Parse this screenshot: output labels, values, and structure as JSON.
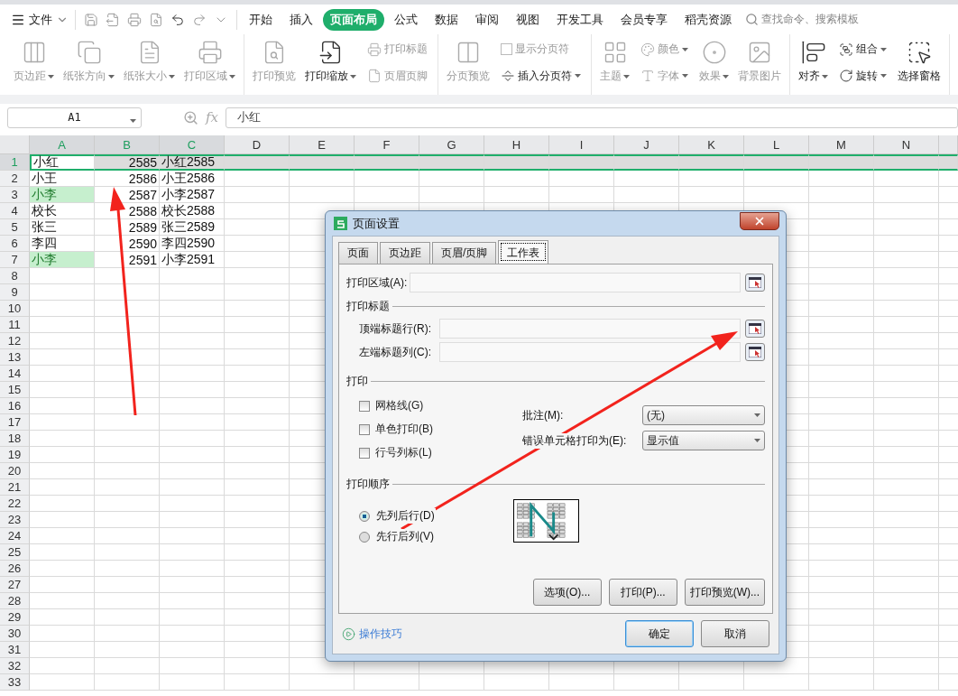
{
  "menu": {
    "file": "文件",
    "tabs": [
      {
        "label": "开始",
        "selected": false
      },
      {
        "label": "插入",
        "selected": false
      },
      {
        "label": "页面布局",
        "selected": true
      },
      {
        "label": "公式",
        "selected": false
      },
      {
        "label": "数据",
        "selected": false
      },
      {
        "label": "审阅",
        "selected": false
      },
      {
        "label": "视图",
        "selected": false
      },
      {
        "label": "开发工具",
        "selected": false
      },
      {
        "label": "会员专享",
        "selected": false
      },
      {
        "label": "稻壳资源",
        "selected": false
      }
    ],
    "search_placeholder": "查找命令、搜索模板"
  },
  "ribbon": [
    {
      "columns": [
        {
          "kind": "large",
          "label": "页边距",
          "dropdown": true,
          "disabled": true
        },
        {
          "kind": "large",
          "label": "纸张方向",
          "dropdown": true,
          "disabled": true
        },
        {
          "kind": "large",
          "label": "纸张大小",
          "dropdown": true,
          "disabled": true
        },
        {
          "kind": "large",
          "label": "打印区域",
          "dropdown": true,
          "disabled": true
        }
      ]
    },
    {
      "columns": [
        {
          "kind": "large",
          "label": "打印预览",
          "dropdown": false,
          "disabled": true
        },
        {
          "kind": "large",
          "label": "打印缩放",
          "dropdown": true,
          "disabled": false
        },
        {
          "kind": "stack",
          "items": [
            {
              "kind": "button",
              "label": "打印标题",
              "dropdown": false,
              "disabled": true
            },
            {
              "kind": "button",
              "label": "页眉页脚",
              "dropdown": false,
              "disabled": true
            }
          ]
        }
      ]
    },
    {
      "columns": [
        {
          "kind": "large",
          "label": "分页预览",
          "dropdown": false,
          "disabled": true
        },
        {
          "kind": "stack",
          "items": [
            {
              "kind": "check",
              "label": "显示分页符",
              "dropdown": false,
              "disabled": true
            },
            {
              "kind": "button",
              "label": "插入分页符",
              "dropdown": true,
              "disabled": false
            }
          ]
        }
      ]
    },
    {
      "columns": [
        {
          "kind": "large",
          "label": "主题",
          "dropdown": true,
          "disabled": true
        },
        {
          "kind": "stack",
          "items": [
            {
              "kind": "button",
              "label": "颜色",
              "dropdown": true,
              "disabled": true
            },
            {
              "kind": "button",
              "label": "字体",
              "dropdown": true,
              "disabled": true
            }
          ]
        },
        {
          "kind": "large",
          "label": "效果",
          "dropdown": true,
          "disabled": true
        },
        {
          "kind": "large",
          "label": "背景图片",
          "dropdown": false,
          "disabled": true
        }
      ]
    },
    {
      "columns": [
        {
          "kind": "large",
          "label": "对齐",
          "dropdown": true,
          "disabled": false
        },
        {
          "kind": "stack",
          "items": [
            {
              "kind": "button",
              "label": "组合",
              "dropdown": true,
              "disabled": false
            },
            {
              "kind": "button",
              "label": "旋转",
              "dropdown": true,
              "disabled": false
            }
          ]
        },
        {
          "kind": "large",
          "label": "选择窗格",
          "dropdown": false,
          "disabled": false
        }
      ]
    }
  ],
  "formula_bar": {
    "cell_ref": "A1",
    "function_symbol": "fx",
    "value": "小红"
  },
  "sheet": {
    "columns": [
      {
        "label": "A",
        "selected": true
      },
      {
        "label": "B",
        "selected": true
      },
      {
        "label": "C",
        "selected": true
      },
      {
        "label": "D",
        "selected": false
      },
      {
        "label": "E",
        "selected": false
      },
      {
        "label": "F",
        "selected": false
      },
      {
        "label": "G",
        "selected": false
      },
      {
        "label": "H",
        "selected": false
      },
      {
        "label": "I",
        "selected": false
      },
      {
        "label": "J",
        "selected": false
      },
      {
        "label": "K",
        "selected": false
      },
      {
        "label": "L",
        "selected": false
      },
      {
        "label": "M",
        "selected": false
      },
      {
        "label": "N",
        "selected": false
      }
    ],
    "rows": [
      {
        "number": "1",
        "selected": true,
        "cells": [
          {
            "text": "小红",
            "kind": "text",
            "highlighted": false
          },
          {
            "text": "2585",
            "kind": "number",
            "highlighted": false
          },
          {
            "text": "小红2585",
            "kind": "text",
            "highlighted": false
          }
        ]
      },
      {
        "number": "2",
        "selected": false,
        "cells": [
          {
            "text": "小王",
            "kind": "text",
            "highlighted": false
          },
          {
            "text": "2586",
            "kind": "number",
            "highlighted": false
          },
          {
            "text": "小王2586",
            "kind": "text",
            "highlighted": false
          }
        ]
      },
      {
        "number": "3",
        "selected": false,
        "cells": [
          {
            "text": "小李",
            "kind": "text",
            "highlighted": true
          },
          {
            "text": "2587",
            "kind": "number",
            "highlighted": false
          },
          {
            "text": "小李2587",
            "kind": "text",
            "highlighted": false
          }
        ]
      },
      {
        "number": "4",
        "selected": false,
        "cells": [
          {
            "text": "校长",
            "kind": "text",
            "highlighted": false
          },
          {
            "text": "2588",
            "kind": "number",
            "highlighted": false
          },
          {
            "text": "校长2588",
            "kind": "text",
            "highlighted": false
          }
        ]
      },
      {
        "number": "5",
        "selected": false,
        "cells": [
          {
            "text": "张三",
            "kind": "text",
            "highlighted": false
          },
          {
            "text": "2589",
            "kind": "number",
            "highlighted": false
          },
          {
            "text": "张三2589",
            "kind": "text",
            "highlighted": false
          }
        ]
      },
      {
        "number": "6",
        "selected": false,
        "cells": [
          {
            "text": "李四",
            "kind": "text",
            "highlighted": false
          },
          {
            "text": "2590",
            "kind": "number",
            "highlighted": false
          },
          {
            "text": "李四2590",
            "kind": "text",
            "highlighted": false
          }
        ]
      },
      {
        "number": "7",
        "selected": false,
        "cells": [
          {
            "text": "小李",
            "kind": "text",
            "highlighted": true
          },
          {
            "text": "2591",
            "kind": "number",
            "highlighted": false
          },
          {
            "text": "小李2591",
            "kind": "text",
            "highlighted": false
          }
        ]
      },
      {
        "number": "8",
        "selected": false
      },
      {
        "number": "9",
        "selected": false
      },
      {
        "number": "10",
        "selected": false
      },
      {
        "number": "11",
        "selected": false
      },
      {
        "number": "12",
        "selected": false
      },
      {
        "number": "13",
        "selected": false
      },
      {
        "number": "14",
        "selected": false
      },
      {
        "number": "15",
        "selected": false
      },
      {
        "number": "16",
        "selected": false
      },
      {
        "number": "17",
        "selected": false
      },
      {
        "number": "18",
        "selected": false
      },
      {
        "number": "19",
        "selected": false
      },
      {
        "number": "20",
        "selected": false
      },
      {
        "number": "21",
        "selected": false
      },
      {
        "number": "22",
        "selected": false
      },
      {
        "number": "23",
        "selected": false
      },
      {
        "number": "24",
        "selected": false
      },
      {
        "number": "25",
        "selected": false
      },
      {
        "number": "26",
        "selected": false
      },
      {
        "number": "27",
        "selected": false
      },
      {
        "number": "28",
        "selected": false
      },
      {
        "number": "29",
        "selected": false
      },
      {
        "number": "30",
        "selected": false
      },
      {
        "number": "31",
        "selected": false
      },
      {
        "number": "32",
        "selected": false
      },
      {
        "number": "33",
        "selected": false
      }
    ]
  },
  "dialog": {
    "title": "页面设置",
    "tabs": [
      {
        "label": "页面",
        "selected": false
      },
      {
        "label": "页边距",
        "selected": false
      },
      {
        "label": "页眉/页脚",
        "selected": false
      },
      {
        "label": "工作表",
        "selected": true
      }
    ],
    "print_area_label": "打印区域(A):",
    "print_titles": {
      "heading": "打印标题",
      "fields": [
        {
          "label": "顶端标题行(R):"
        },
        {
          "label": "左端标题列(C):"
        }
      ]
    },
    "print": {
      "heading": "打印",
      "checkboxes": [
        {
          "label": "网格线(G)",
          "checked": false
        },
        {
          "label": "单色打印(B)",
          "checked": false
        },
        {
          "label": "行号列标(L)",
          "checked": false
        }
      ],
      "selects": [
        {
          "label": "批注(M):",
          "value": "(无)"
        },
        {
          "label": "错误单元格打印为(E):",
          "value": "显示值"
        }
      ]
    },
    "print_order": {
      "heading": "打印顺序",
      "options": [
        {
          "label": "先列后行(D)",
          "selected": true
        },
        {
          "label": "先行后列(V)",
          "selected": false
        }
      ]
    },
    "buttons": [
      "选项(O)...",
      "打印(P)...",
      "打印预览(W)..."
    ],
    "tips_link": "操作技巧",
    "footer_buttons": [
      {
        "label": "确定",
        "kind": "default"
      },
      {
        "label": "取消",
        "kind": "normal"
      }
    ]
  }
}
